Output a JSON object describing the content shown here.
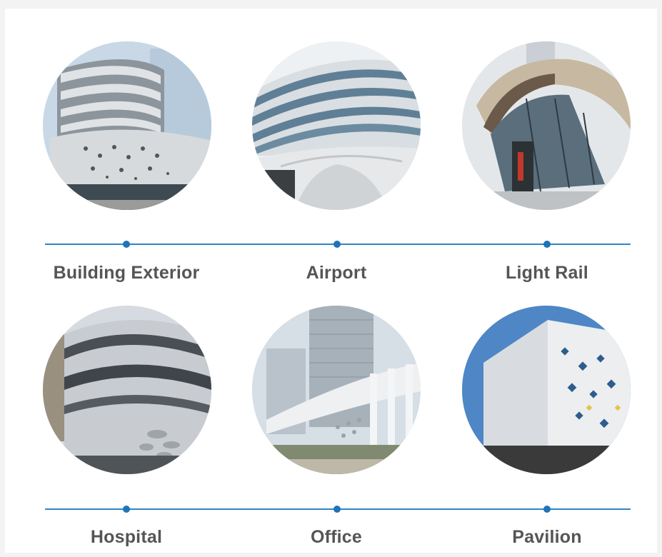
{
  "row1": {
    "labels": [
      "Building Exterior",
      "Airport",
      "Light Rail"
    ]
  },
  "row2": {
    "labels": [
      "Hospital",
      "Office",
      "Pavilion"
    ]
  },
  "colors": {
    "timeline": "#2f86c4",
    "dot": "#1f74b8",
    "label": "#555555"
  }
}
